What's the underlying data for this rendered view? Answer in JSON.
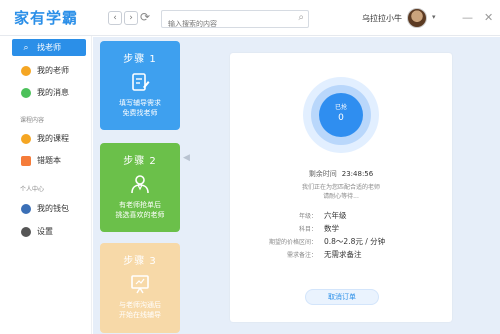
{
  "app": {
    "logo_text": "家有学霸"
  },
  "topbar": {
    "back_glyph": "‹",
    "forward_glyph": "›",
    "refresh_glyph": "⟳",
    "search_placeholder": "输入搜索的内容",
    "search_glyph": "⌕",
    "username": "乌拉拉小牛",
    "caret_glyph": "▾",
    "minimize_glyph": "—",
    "close_glyph": "✕"
  },
  "sidebar": {
    "find_teacher": "找老师",
    "my_teachers": "我的老师",
    "my_messages": "我的消息",
    "section_course": "课程内容",
    "my_courses": "我的课程",
    "wrong_book": "错题本",
    "section_personal": "个人中心",
    "my_wallet": "我的钱包",
    "settings": "设置"
  },
  "steps": [
    {
      "title": "步骤 1",
      "line1": "填写辅导需求",
      "line2": "免费找老师"
    },
    {
      "title": "步骤 2",
      "line1": "有老师抢单后",
      "line2": "挑选喜欢的老师"
    },
    {
      "title": "步骤 3",
      "line1": "与老师沟通后",
      "line2": "开始在线辅导"
    }
  ],
  "order": {
    "grabbed_label": "已抢",
    "grabbed_count": "0",
    "remaining_label": "剩余时间",
    "remaining_time": "23:48:56",
    "message_line1": "我们正在为您匹配合适的老师",
    "message_line2": "请耐心等待...",
    "fields": [
      {
        "key": "年级：",
        "value": "六年级"
      },
      {
        "key": "科目：",
        "value": "数学"
      },
      {
        "key": "期望的价格区间：",
        "value": "0.8～2.8元 / 分钟"
      },
      {
        "key": "需求备注：",
        "value": "无需求备注"
      }
    ],
    "cancel_label": "取消订单"
  },
  "colors": {
    "primary": "#2b8fe8",
    "step2": "#6bc04a",
    "step3": "#f7d9a8",
    "main_bg": "#e6eef9"
  }
}
